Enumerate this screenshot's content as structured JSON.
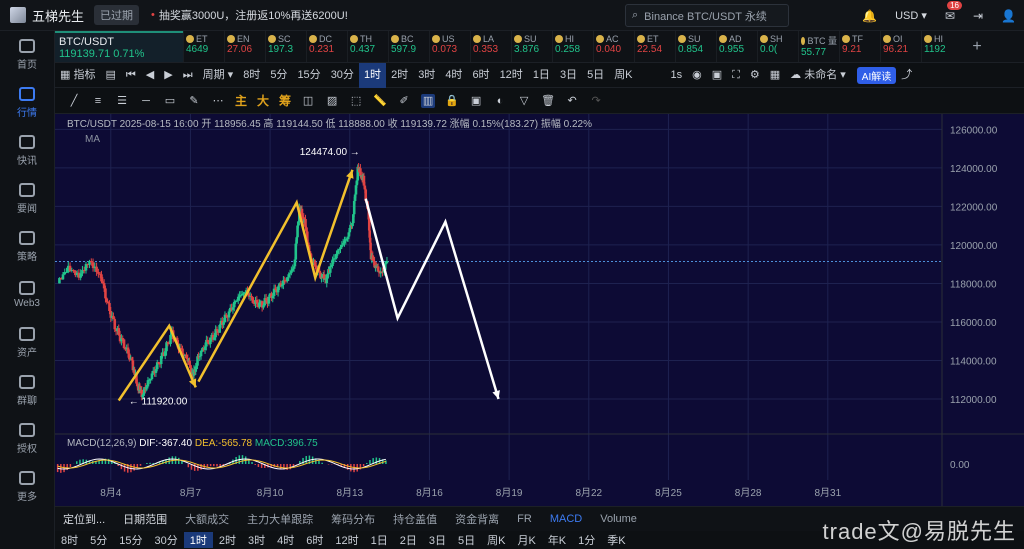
{
  "app": {
    "name": "五梯先生",
    "login_badge": "已过期"
  },
  "promo": "抽奖赢3000U，注册返10%再送6200U!",
  "search": {
    "placeholder": "Binance BTC/USDT 永续"
  },
  "currency": "USD",
  "notifications": "16",
  "sidebar": [
    {
      "label": "首页"
    },
    {
      "label": "行情"
    },
    {
      "label": "快讯"
    },
    {
      "label": "要闻"
    },
    {
      "label": "策略"
    },
    {
      "label": "Web3"
    },
    {
      "label": "资产"
    },
    {
      "label": "群聊"
    },
    {
      "label": "授权"
    },
    {
      "label": "更多"
    }
  ],
  "ticker": {
    "main": {
      "symbol": "BTC/USDT",
      "price": "119139.71",
      "change": "0.71%"
    },
    "items": [
      {
        "s": "ET",
        "p": "4649",
        "c": "up"
      },
      {
        "s": "EN",
        "p": "27.06",
        "c": "dn"
      },
      {
        "s": "SC",
        "p": "197.3",
        "c": "up"
      },
      {
        "s": "DC",
        "p": "0.231",
        "c": "dn"
      },
      {
        "s": "TH",
        "p": "0.437",
        "c": "up"
      },
      {
        "s": "BC",
        "p": "597.9",
        "c": "up"
      },
      {
        "s": "US",
        "p": "0.073",
        "c": "dn"
      },
      {
        "s": "LA",
        "p": "0.353",
        "c": "dn"
      },
      {
        "s": "SU",
        "p": "3.876",
        "c": "up"
      },
      {
        "s": "HI",
        "p": "0.258",
        "c": "up"
      },
      {
        "s": "AC",
        "p": "0.040",
        "c": "dn"
      },
      {
        "s": "ET",
        "p": "22.54",
        "c": "dn"
      },
      {
        "s": "SU",
        "p": "0.854",
        "c": "up"
      },
      {
        "s": "AD",
        "p": "0.955",
        "c": "up"
      },
      {
        "s": "SH",
        "p": "0.0(",
        "c": "up"
      },
      {
        "s": "BTC 量",
        "p": "55.77",
        "c": "up"
      },
      {
        "s": "TF",
        "p": "9.21",
        "c": "dn"
      },
      {
        "s": "OI",
        "p": "96.21",
        "c": "dn"
      },
      {
        "s": "HI",
        "p": "1192",
        "c": "up"
      }
    ]
  },
  "toolbar1": {
    "indicators": "指标",
    "period": "周期",
    "intervals": [
      "8时",
      "5分",
      "15分",
      "30分",
      "1时",
      "2时",
      "3时",
      "4时",
      "6时",
      "12时",
      "1日",
      "3日",
      "5日",
      "周K"
    ],
    "selected": "1时",
    "interval_right": "1s",
    "unnamed": "未命名",
    "ai": "AI解读"
  },
  "toolbar2": {
    "text_tools": [
      "主",
      "大",
      "筹"
    ]
  },
  "chart_data": {
    "type": "candlestick",
    "symbol": "BTC/USDT",
    "info": {
      "symbol": "BTC/USDT",
      "date": "2025-08-15 16:00",
      "open_label": "开",
      "open": "118956.45",
      "high_label": "高",
      "high": "119144.50",
      "low_label": "低",
      "low": "118888.00",
      "close_label": "收",
      "close": "119139.72",
      "change_label": "涨幅",
      "change": "0.15%(183.27)",
      "amp_label": "振幅",
      "amp": "0.22%"
    },
    "ma_label": "MA",
    "y_ticks": [
      126000,
      124000,
      122000,
      120000,
      118000,
      116000,
      114000,
      112000
    ],
    "y_tick_labels": [
      "126000.00",
      "124000.00",
      "122000.00",
      "120000.00",
      "118000.00",
      "116000.00",
      "114000.00",
      "112000.00"
    ],
    "ylim": [
      110700,
      126800
    ],
    "current_price": 119139.72,
    "x_labels": [
      "8月4",
      "8月7",
      "8月10",
      "8月13",
      "8月16",
      "8月19",
      "8月22",
      "8月25",
      "8月28",
      "8月31"
    ],
    "x_label_day": [
      4,
      7,
      10,
      13,
      16,
      19,
      22,
      25,
      28,
      31
    ],
    "x_day_range": [
      1.9,
      35.3
    ],
    "annotations": [
      {
        "text": "124474.00",
        "day": 13.3,
        "price": 124474
      },
      {
        "text": "111920.00",
        "day": 4.3,
        "price": 111920
      }
    ],
    "close_series": [
      [
        2.0,
        118000
      ],
      [
        2.4,
        118700
      ],
      [
        2.8,
        118300
      ],
      [
        3.2,
        119200
      ],
      [
        3.6,
        118500
      ],
      [
        3.9,
        116800
      ],
      [
        4.2,
        115600
      ],
      [
        4.5,
        114800
      ],
      [
        4.8,
        113900
      ],
      [
        5.0,
        112700
      ],
      [
        5.2,
        112200
      ],
      [
        5.4,
        112900
      ],
      [
        5.7,
        113600
      ],
      [
        6.0,
        114400
      ],
      [
        6.3,
        115400
      ],
      [
        6.6,
        114600
      ],
      [
        6.9,
        114000
      ],
      [
        7.1,
        113200
      ],
      [
        7.3,
        114200
      ],
      [
        7.6,
        114900
      ],
      [
        7.9,
        115300
      ],
      [
        8.2,
        116000
      ],
      [
        8.5,
        116600
      ],
      [
        8.8,
        117300
      ],
      [
        9.1,
        117600
      ],
      [
        9.4,
        117000
      ],
      [
        9.7,
        116900
      ],
      [
        10.0,
        117300
      ],
      [
        10.3,
        117800
      ],
      [
        10.6,
        118200
      ],
      [
        10.9,
        118900
      ],
      [
        11.1,
        121900
      ],
      [
        11.3,
        121200
      ],
      [
        11.5,
        119400
      ],
      [
        11.7,
        118900
      ],
      [
        11.9,
        118400
      ],
      [
        12.1,
        118200
      ],
      [
        12.3,
        119000
      ],
      [
        12.6,
        119800
      ],
      [
        12.9,
        120400
      ],
      [
        13.1,
        121200
      ],
      [
        13.3,
        124000
      ],
      [
        13.5,
        123400
      ],
      [
        13.7,
        121600
      ],
      [
        13.8,
        119400
      ],
      [
        14.0,
        118800
      ],
      [
        14.2,
        118500
      ],
      [
        14.4,
        119100
      ]
    ],
    "macd": {
      "label": "MACD(12,26,9)",
      "dif_label": "DIF",
      "dif": "-367.40",
      "dea_label": "DEA",
      "dea": "-565.78",
      "macd_label": "MACD",
      "macd": "396.75",
      "zero_label": "0.00"
    },
    "overlay_paths": {
      "yellow": [
        [
          [
            4.3,
            111920
          ],
          [
            6.2,
            115800
          ],
          [
            7.2,
            112600
          ]
        ],
        [
          [
            7.3,
            112900
          ],
          [
            11.0,
            122200
          ],
          [
            11.7,
            118300
          ],
          [
            13.1,
            123900
          ]
        ]
      ],
      "white": [
        [
          [
            13.6,
            122400
          ],
          [
            14.8,
            116200
          ],
          [
            16.6,
            121200
          ],
          [
            18.6,
            112000
          ]
        ]
      ]
    }
  },
  "bottombar1": [
    "定位到...",
    "日期范围",
    "大额成交",
    "主力大单跟踪",
    "筹码分布",
    "持仓盖值",
    "资金背离",
    "FR",
    "MACD",
    "Volume"
  ],
  "bottombar2": [
    "8时",
    "5分",
    "15分",
    "30分",
    "1时",
    "2时",
    "3时",
    "4时",
    "6时",
    "12时",
    "1日",
    "2日",
    "3日",
    "5日",
    "周K",
    "月K",
    "年K",
    "1分",
    "季K"
  ],
  "bottombar2_selected": "1时",
  "watermark": "trade文@易脱先生",
  "colors": {
    "up": "#21c38b",
    "down": "#e04343",
    "bg_chart": "#0d0b35",
    "accent": "#3d7bf2",
    "yellow": "#f2c02d"
  }
}
